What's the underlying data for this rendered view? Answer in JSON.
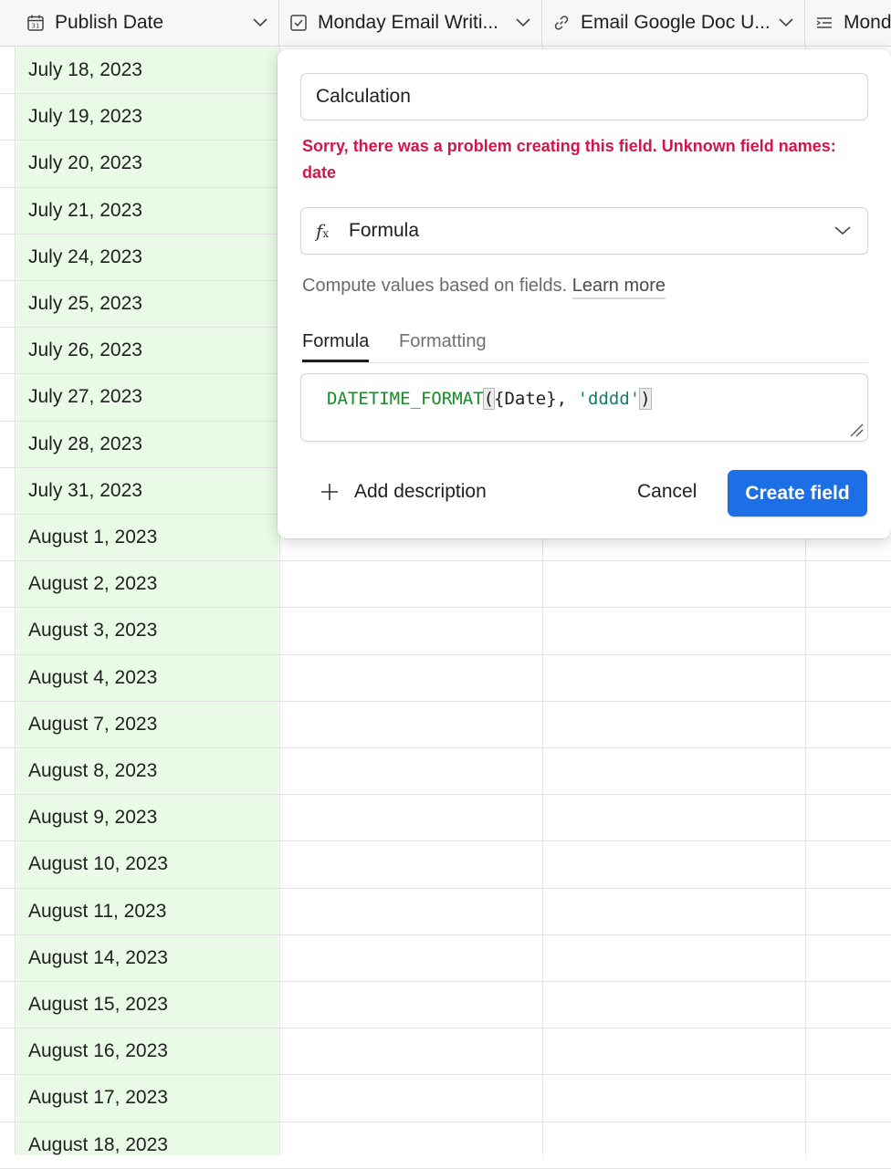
{
  "headers": [
    {
      "label": "Publish Date",
      "icon": "calendar-icon"
    },
    {
      "label": "Monday Email Writi...",
      "icon": "checkbox-icon"
    },
    {
      "label": "Email Google Doc U...",
      "icon": "link-icon"
    },
    {
      "label": "Mond",
      "icon": "text-lines-icon"
    }
  ],
  "dates": [
    "July 18, 2023",
    "July 19, 2023",
    "July 20, 2023",
    "July 21, 2023",
    "July 24, 2023",
    "July 25, 2023",
    "July 26, 2023",
    "July 27, 2023",
    "July 28, 2023",
    "July 31, 2023",
    "August 1, 2023",
    "August 2, 2023",
    "August 3, 2023",
    "August 4, 2023",
    "August 7, 2023",
    "August 8, 2023",
    "August 9, 2023",
    "August 10, 2023",
    "August 11, 2023",
    "August 14, 2023",
    "August 15, 2023",
    "August 16, 2023",
    "August 17, 2023",
    "August 18, 2023"
  ],
  "modal": {
    "field_name": "Calculation",
    "error": "Sorry, there was a problem creating this field. Unknown field names: date",
    "field_type": "Formula",
    "description": "Compute values based on fields.",
    "learn_more": "Learn more",
    "tabs": [
      "Formula",
      "Formatting"
    ],
    "formula": {
      "fn": "DATETIME_FORMAT",
      "open": "(",
      "arg1": "{Date}, ",
      "arg2": "'dddd'",
      "close": ")"
    },
    "add_description": "Add description",
    "cancel": "Cancel",
    "create": "Create field"
  },
  "colors": {
    "date_column_bg": "#e9fbe6",
    "error": "#d0164a",
    "primary_button": "#1d6fe6"
  }
}
